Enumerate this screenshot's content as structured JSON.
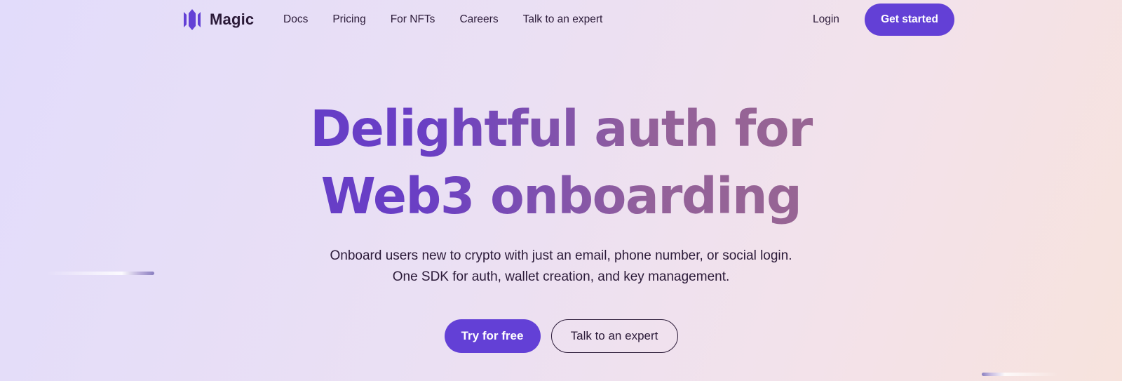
{
  "brand": {
    "name": "Magic",
    "logo_icon": "magic-logo-icon",
    "accent_color": "#6340d6"
  },
  "nav": {
    "links": [
      "Docs",
      "Pricing",
      "For NFTs",
      "Careers",
      "Talk to an expert"
    ],
    "login_label": "Login",
    "get_started_label": "Get started"
  },
  "hero": {
    "title_line1": "Delightful auth for",
    "title_line2": "Web3 onboarding",
    "subtitle_line1": "Onboard users new to crypto with just an email, phone number, or social login.",
    "subtitle_line2": "One SDK for auth, wallet creation, and key management.",
    "primary_cta": "Try for free",
    "secondary_cta": "Talk to an expert"
  }
}
